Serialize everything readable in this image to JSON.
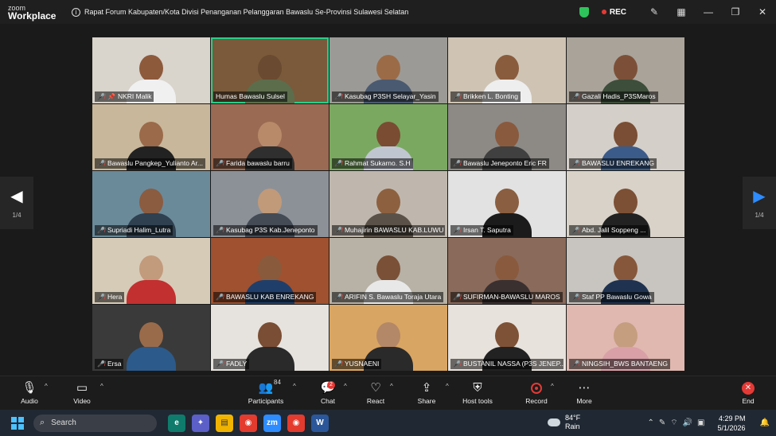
{
  "app": {
    "brand_top": "zoom",
    "brand_bottom": "Workplace"
  },
  "meeting": {
    "title": "Rapat Forum Kabupaten/Kota Divisi Penanganan Pelanggaran Bawaslu Se-Provinsi Sulawesi Selatan",
    "rec_label": "REC"
  },
  "pager": {
    "left": "1/4",
    "right": "1/4"
  },
  "participants": [
    {
      "name": "NKRI Malik",
      "bg": "#d9d4cc",
      "skin": "#8d5a3c",
      "shirt": "#f0f0f0",
      "pinned": true
    },
    {
      "name": "Humas Bawaslu Sulsel",
      "bg": "#7a5a3a",
      "skin": "#6a4a30",
      "shirt": "#5c6d4c",
      "active": true
    },
    {
      "name": "Kasubag P3SH Selayar_Yasin",
      "bg": "#9c9a96",
      "skin": "#9b6b48",
      "shirt": "#4a5a70"
    },
    {
      "name": "Brikken L. Bonting",
      "bg": "#cfc4b4",
      "skin": "#8a5c3e",
      "shirt": "#eeeeee"
    },
    {
      "name": "Gazali Hadis_P3SMaros",
      "bg": "#a9a39a",
      "skin": "#7c5038",
      "shirt": "#3d4e3a"
    },
    {
      "name": "Bawaslu Pangkep_Yulianto Ar...",
      "bg": "#c8b79a",
      "skin": "#9a6a4a",
      "shirt": "#222222"
    },
    {
      "name": "Farida bawaslu barru",
      "bg": "#9b6a52",
      "skin": "#b88a6a",
      "shirt": "#2f2f2f"
    },
    {
      "name": "Rahmat Sukarno. S.H",
      "bg": "#7aa861",
      "skin": "#7a4c32",
      "shirt": "#c0c6d0"
    },
    {
      "name": "Bawaslu Jeneponto Eric FR",
      "bg": "#8d8a86",
      "skin": "#8a5a3e",
      "shirt": "#404040"
    },
    {
      "name": "BAWASLU ENREKANG",
      "bg": "#d4cfc8",
      "skin": "#7a4e34",
      "shirt": "#3b5b8a"
    },
    {
      "name": "Supriadi Halim_Lutra",
      "bg": "#6a8a9a",
      "skin": "#8b5c40",
      "shirt": "#2f4050"
    },
    {
      "name": "Kasubag P3S Kab.Jeneponto",
      "bg": "#8c9198",
      "skin": "#c19a7a",
      "shirt": "#444b55"
    },
    {
      "name": "Muhajirin BAWASLU KAB.LUWU U...",
      "bg": "#bfb7ad",
      "skin": "#8d603f",
      "shirt": "#5a5248"
    },
    {
      "name": "Irsan T. Saputra",
      "bg": "#e2e2e2",
      "skin": "#8a5e40",
      "shirt": "#1b1b1b"
    },
    {
      "name": "Abd. Jalil Soppeng ...",
      "bg": "#d8d2c8",
      "skin": "#7c5035",
      "shirt": "#222222"
    },
    {
      "name": "Hera",
      "bg": "#d6cbb7",
      "skin": "#c29a7c",
      "shirt": "#c23030"
    },
    {
      "name": "BAWASLU KAB ENREKANG",
      "bg": "#a0512f",
      "skin": "#8a5a3c",
      "shirt": "#1f3f6a"
    },
    {
      "name": "ARIFIN S. Bawaslu Toraja Utara",
      "bg": "#b7b1a6",
      "skin": "#7a5036",
      "shirt": "#e8e8e8"
    },
    {
      "name": "SUFIRMAN-BAWASLU MAROS",
      "bg": "#8a6a5a",
      "skin": "#8a5a3e",
      "shirt": "#3a3030"
    },
    {
      "name": "Staf PP Bawaslu Gowa",
      "bg": "#c8c4bf",
      "skin": "#86573a",
      "shirt": "#1f3350"
    },
    {
      "name": "Ersa",
      "bg": "#3a3a3a",
      "skin": "#9a6b4a",
      "shirt": "#2c5a8a"
    },
    {
      "name": "FADLY",
      "bg": "#e6e3de",
      "skin": "#7a4e34",
      "shirt": "#2a2a2a"
    },
    {
      "name": "YUSNAENI",
      "bg": "#d9a562",
      "skin": "#b38868",
      "shirt": "#2a2a2a"
    },
    {
      "name": "BUSTANIL NASSA (P3S JENEP...",
      "bg": "#e8e2dc",
      "skin": "#7e5236",
      "shirt": "#222222"
    },
    {
      "name": "NINGSIH_BWS BANTAENG",
      "bg": "#e0b8b0",
      "skin": "#c59e80",
      "shirt": "#d9a0a8"
    }
  ],
  "toolbar": {
    "audio": "Audio",
    "video": "Video",
    "participants": "Participants",
    "participants_count": "84",
    "chat": "Chat",
    "chat_badge": "2",
    "react": "React",
    "share": "Share",
    "host_tools": "Host tools",
    "record": "Record",
    "more": "More",
    "end": "End"
  },
  "taskbar": {
    "search_placeholder": "Search",
    "temp": "84°F",
    "weather": "Rain",
    "time": "4:29 PM",
    "date": "5/1/2026"
  }
}
